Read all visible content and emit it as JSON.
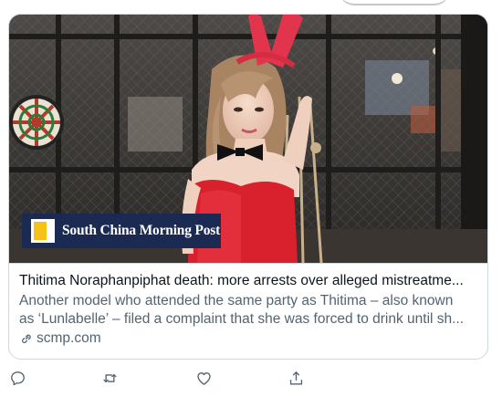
{
  "card": {
    "publisher_logo": "South China Morning Post",
    "title": "Thitima Noraphanpiphat death: more arrests over alleged mistreatme...",
    "description_line1": "Another model who attended the same party as Thitima – also known",
    "description_line2": "as ‘Lunlabelle’ – filed a complaint that she was forced to drink until sh...",
    "domain": "scmp.com",
    "link_icon": "link-icon"
  },
  "actions": [
    {
      "name": "reply",
      "icon": "reply-icon"
    },
    {
      "name": "retweet",
      "icon": "retweet-icon"
    },
    {
      "name": "like",
      "icon": "heart-icon"
    },
    {
      "name": "share",
      "icon": "share-icon"
    }
  ],
  "colors": {
    "title": "#0f1419",
    "secondary": "#536471",
    "border": "#cfd9de",
    "logo_bg": "#1b2a52",
    "logo_accent": "#f6c21a"
  }
}
